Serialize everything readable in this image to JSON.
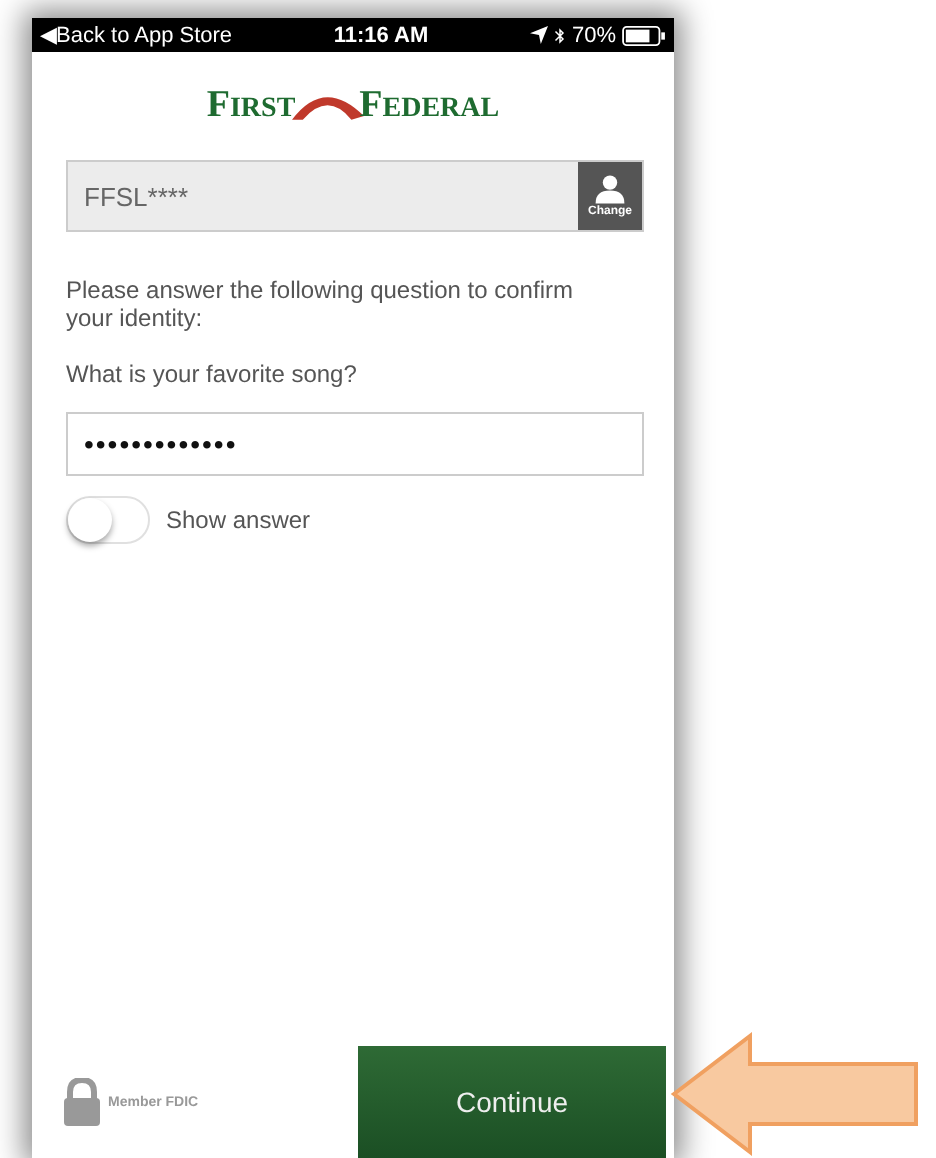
{
  "status_bar": {
    "back": "◀Back to App Store",
    "time": "11:16 AM",
    "battery": "70%"
  },
  "logo": {
    "word_1": "FIRST",
    "word_2": "FEDERAL"
  },
  "username_field": {
    "value": "FFSL****",
    "button": "Change"
  },
  "prompt": "Please answer the following question to confirm your identity:",
  "question": "What is your favorite song?",
  "answer_field": {
    "value": "•••••••••••••"
  },
  "show_answer": {
    "label": "Show answer",
    "on": false
  },
  "footer": {
    "fdic": "Member FDIC",
    "button": "Continue"
  }
}
